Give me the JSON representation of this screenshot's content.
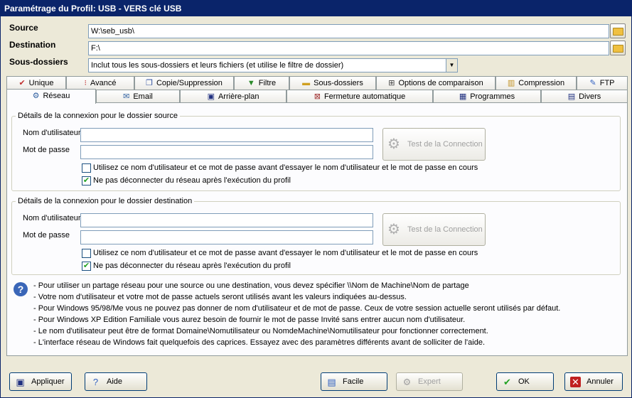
{
  "window": {
    "title": "Paramétrage du Profil: USB - VERS clé USB"
  },
  "form": {
    "source_label": "Source",
    "source_value": "W:\\seb_usb\\",
    "destination_label": "Destination",
    "destination_value": "F:\\",
    "subfolders_label": "Sous-dossiers",
    "subfolders_value": "Inclut tous les sous-dossiers et leurs fichiers (et utilise le filtre de dossier)"
  },
  "tabs_row1": [
    {
      "label": "Unique",
      "icon": "checkmark-icon"
    },
    {
      "label": "Avancé",
      "icon": "advanced-icon"
    },
    {
      "label": "Copie/Suppression",
      "icon": "copy-icon"
    },
    {
      "label": "Filtre",
      "icon": "filter-icon"
    },
    {
      "label": "Sous-dossiers",
      "icon": "folders-icon"
    },
    {
      "label": "Options de comparaison",
      "icon": "compare-icon"
    },
    {
      "label": "Compression",
      "icon": "compress-icon"
    },
    {
      "label": "FTP",
      "icon": "ftp-icon"
    }
  ],
  "tabs_row2": [
    {
      "label": "Réseau",
      "icon": "network-icon"
    },
    {
      "label": "Email",
      "icon": "email-icon"
    },
    {
      "label": "Arrière-plan",
      "icon": "background-icon"
    },
    {
      "label": "Fermeture automatique",
      "icon": "auto-close-icon"
    },
    {
      "label": "Programmes",
      "icon": "programs-icon"
    },
    {
      "label": "Divers",
      "icon": "misc-icon"
    }
  ],
  "source_group": {
    "title": "Détails de la connexion pour le dossier source",
    "username_label": "Nom d'utilisateur",
    "username_value": "",
    "password_label": "Mot de passe",
    "password_value": "",
    "test_button": "Test de la Connection",
    "check1": "Utilisez ce nom d'utilisateur et ce mot de passe avant d'essayer le nom d'utilisateur et le mot de passe en cours",
    "check1_checked": false,
    "check2": "Ne pas déconnecter du réseau après l'exécution du profil",
    "check2_checked": true
  },
  "dest_group": {
    "title": "Détails de la connexion pour le dossier destination",
    "username_label": "Nom d'utilisateur",
    "username_value": "",
    "password_label": "Mot de passe",
    "password_value": "",
    "test_button": "Test de la Connection",
    "check1": "Utilisez ce nom d'utilisateur et ce mot de passe avant d'essayer le nom d'utilisateur et le mot de passe en cours",
    "check1_checked": false,
    "check2": "Ne pas déconnecter du réseau après l'exécution du profil",
    "check2_checked": true
  },
  "notes": [
    "- Pour utiliser un partage réseau pour une source ou une destination, vous devez spécifier \\\\Nom de Machine\\Nom de partage",
    "- Votre nom d'utilisateur et votre mot de passe actuels seront utilisés avant les valeurs indiquées au-dessus.",
    "- Pour Windows 95/98/Me vous ne pouvez pas donner de nom d'utilisateur et de mot de passe. Ceux de votre session actuelle seront utilisés par défaut.",
    "- Pour Windows XP Edition Familiale vous aurez besoin de fournir le mot de passe Invité sans entrer aucun nom d'utilisateur.",
    "- Le nom d'utilisateur peut être de format Domaine\\Nomutilisateur ou NomdeMachine\\Nomutilisateur pour fonctionner correctement.",
    "- L'interface réseau de Windows fait quelquefois des caprices. Essayez avec des paramètres différents avant de solliciter de l'aide."
  ],
  "buttons": {
    "apply": "Appliquer",
    "help": "Aide",
    "easy": "Facile",
    "expert": "Expert",
    "ok": "OK",
    "cancel": "Annuler"
  }
}
